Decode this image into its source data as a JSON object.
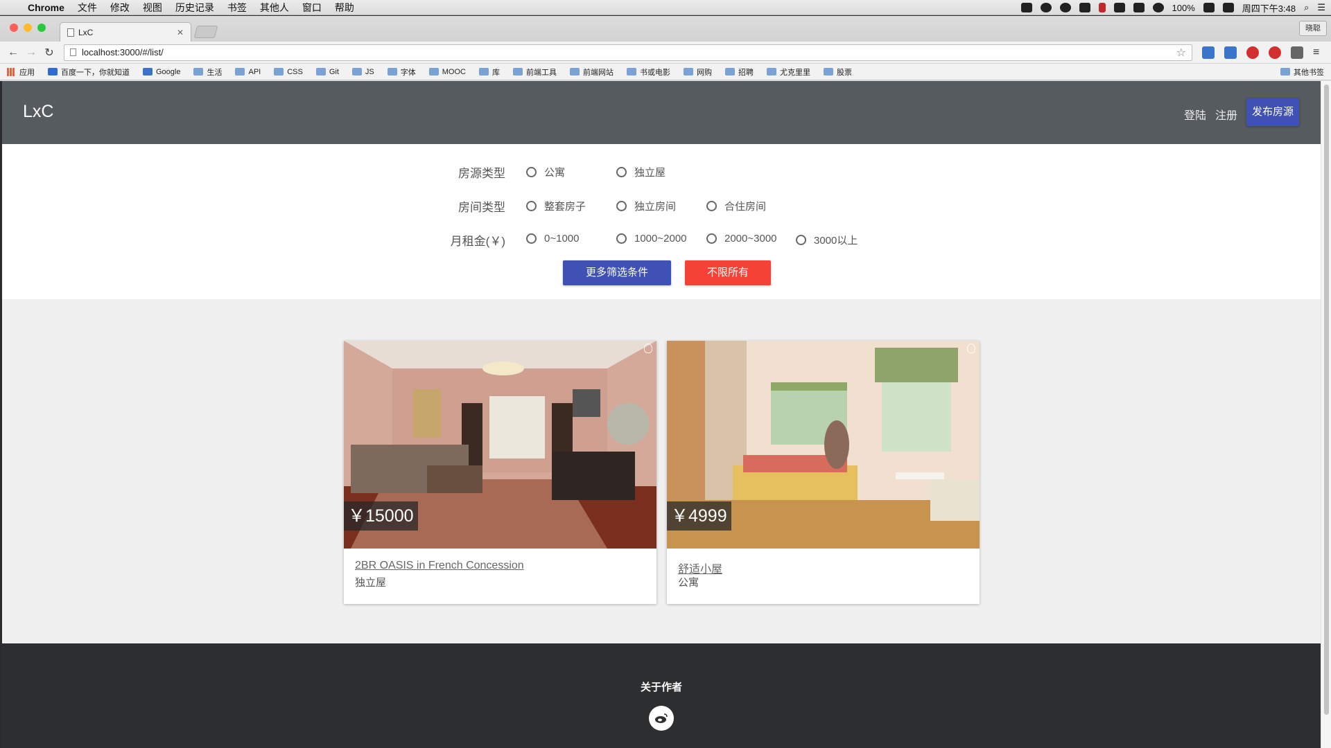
{
  "menubar": {
    "app": "Chrome",
    "items": [
      "文件",
      "修改",
      "视图",
      "历史记录",
      "书签",
      "其他人",
      "窗口",
      "帮助"
    ],
    "battery": "100%",
    "clock": "周四下午3:48"
  },
  "browser": {
    "tab_title": "LxC",
    "profile": "晓聪",
    "url": "localhost:3000/#/list/",
    "bookmarks": [
      "应用",
      "百度一下，你就知道",
      "Google",
      "生活",
      "API",
      "CSS",
      "Git",
      "JS",
      "字体",
      "MOOC",
      "库",
      "前端工具",
      "前端网站",
      "书或电影",
      "网购",
      "招聘",
      "尤克里里",
      "股票"
    ],
    "other_bookmarks": "其他书签"
  },
  "header": {
    "logo": "LxC",
    "login": "登陆",
    "register": "注册",
    "publish": "发布房源"
  },
  "filters": {
    "property_type": {
      "label": "房源类型",
      "options": [
        "公寓",
        "独立屋"
      ]
    },
    "room_type": {
      "label": "房间类型",
      "options": [
        "整套房子",
        "独立房间",
        "合住房间"
      ]
    },
    "rent": {
      "label": "月租金(￥)",
      "options": [
        "0~1000",
        "1000~2000",
        "2000~3000",
        "3000以上"
      ]
    },
    "more_button": "更多筛选条件",
    "reset_button": "不限所有"
  },
  "listings": [
    {
      "price": "￥15000",
      "title": "2BR OASIS in French Concession",
      "type": "独立屋"
    },
    {
      "price": "￥4999",
      "title": "舒适小屋",
      "type": "公寓"
    }
  ],
  "footer": {
    "title": "关于作者"
  },
  "colors": {
    "primary": "#3f51b5",
    "danger": "#f44336",
    "header_bg": "#565b60",
    "footer_bg": "#2d2e30"
  }
}
